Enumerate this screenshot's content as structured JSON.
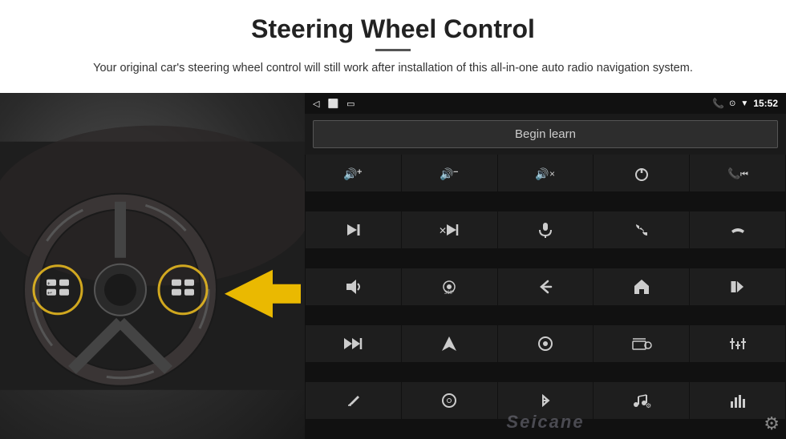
{
  "header": {
    "title": "Steering Wheel Control",
    "subtitle": "Your original car's steering wheel control will still work after installation of this all-in-one auto radio navigation system."
  },
  "status_bar": {
    "left_icons": [
      "◁",
      "⬜",
      "▭"
    ],
    "right_icons": [
      "📞",
      "⊙",
      "▼",
      "15:52"
    ]
  },
  "begin_learn": {
    "label": "Begin learn"
  },
  "controls": [
    {
      "icon": "🔊+",
      "label": "vol-up"
    },
    {
      "icon": "🔊−",
      "label": "vol-down"
    },
    {
      "icon": "🔇",
      "label": "mute"
    },
    {
      "icon": "⏻",
      "label": "power"
    },
    {
      "icon": "📞⏮",
      "label": "call-prev"
    },
    {
      "icon": "⏭",
      "label": "next-track"
    },
    {
      "icon": "✕⏭",
      "label": "skip-next"
    },
    {
      "icon": "🎤",
      "label": "mic"
    },
    {
      "icon": "📞",
      "label": "call"
    },
    {
      "icon": "↩",
      "label": "hang-up"
    },
    {
      "icon": "📢",
      "label": "speaker"
    },
    {
      "icon": "360°",
      "label": "360-cam"
    },
    {
      "icon": "↩",
      "label": "back"
    },
    {
      "icon": "🏠",
      "label": "home"
    },
    {
      "icon": "⏮⏮",
      "label": "prev-track"
    },
    {
      "icon": "⏭⏭",
      "label": "fast-forward"
    },
    {
      "icon": "▲",
      "label": "nav"
    },
    {
      "icon": "⏏",
      "label": "eject"
    },
    {
      "icon": "📻",
      "label": "radio"
    },
    {
      "icon": "⚙️",
      "label": "eq"
    },
    {
      "icon": "🎙",
      "label": "record"
    },
    {
      "icon": "🎯",
      "label": "target"
    },
    {
      "icon": "✱",
      "label": "bluetooth"
    },
    {
      "icon": "🎵",
      "label": "music"
    },
    {
      "icon": "📊",
      "label": "spectrum"
    }
  ],
  "watermark": "Seicane",
  "gear_icon": "⚙"
}
